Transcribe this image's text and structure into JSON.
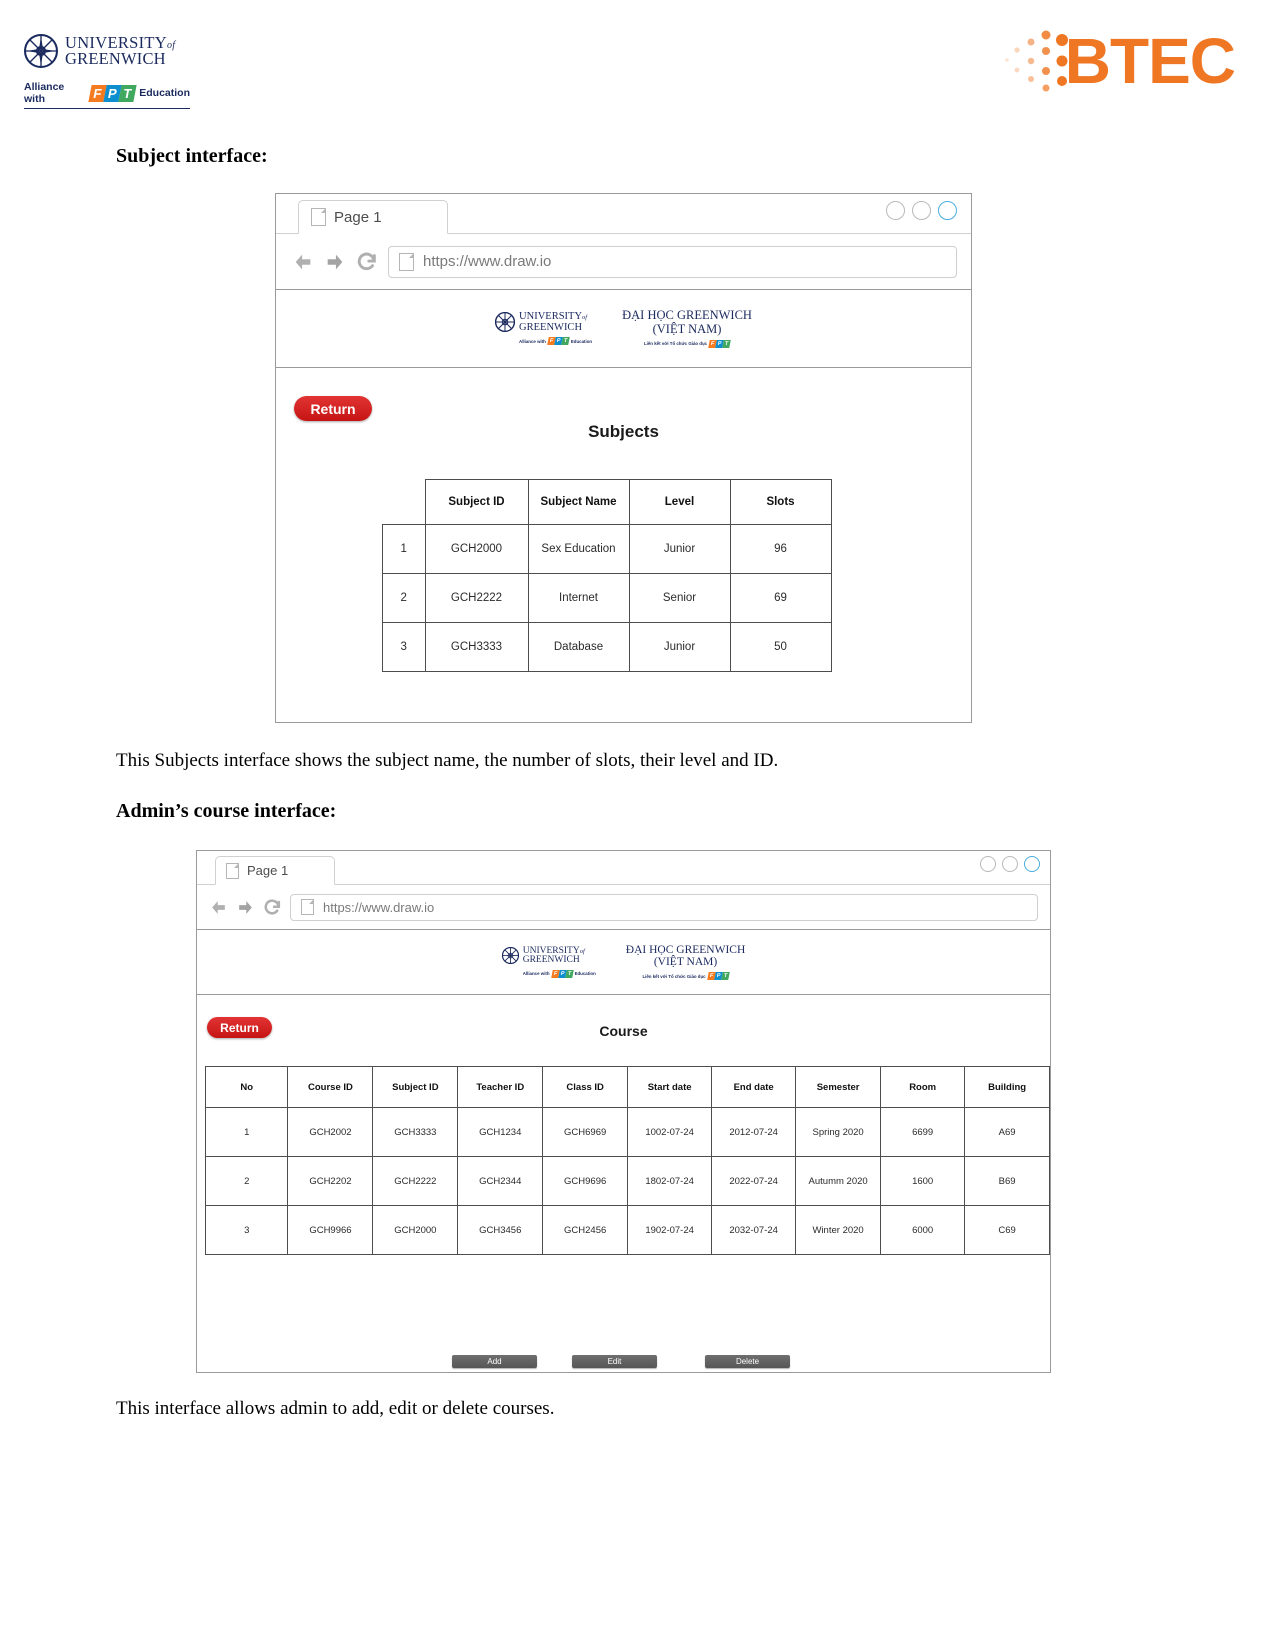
{
  "page_header": {
    "university_logo": {
      "icon": "greenwich-compass-icon",
      "line1": "UNIVERSITY",
      "line1_suffix": "of",
      "line2": "GREENWICH",
      "alliance_prefix": "Alliance with",
      "alliance_brand": "FPT",
      "alliance_suffix": "Education"
    },
    "btec_logo": {
      "icon": "btec-dots-icon",
      "text": "BTEC"
    }
  },
  "document": {
    "heading_1": "Subject interface:",
    "paragraph_1": "This Subjects interface shows the subject name, the number of slots, their level and ID.",
    "heading_2": "Admin’s course interface:",
    "paragraph_2": "This interface allows admin to add, edit or delete courses."
  },
  "browser_chrome": {
    "tab_label": "Page 1",
    "tab_icon": "page-icon",
    "back_icon": "back-arrow-icon",
    "forward_icon": "forward-arrow-icon",
    "reload_icon": "reload-icon",
    "url_icon": "page-icon",
    "url": "https://www.draw.io",
    "window_dots": [
      "minimize-dot",
      "maximize-dot",
      "close-dot"
    ]
  },
  "app_banner": {
    "uog_line1": "UNIVERSITY",
    "uog_of": "of",
    "uog_line2": "GREENWICH",
    "uog_alliance_prefix": "Alliance with",
    "uog_alliance_brand": "FPT",
    "uog_alliance_suffix": "Education",
    "vn_line1": "ĐẠI HỌC GREENWICH",
    "vn_line2": "(VIỆT NAM)",
    "vn_alliance_prefix": "Liên kết với Tổ chức Giáo dục",
    "vn_alliance_brand": "FPT"
  },
  "subjects_screen": {
    "return_label": "Return",
    "title": "Subjects",
    "table": {
      "corner": "",
      "columns": [
        "Subject ID",
        "Subject Name",
        "Level",
        "Slots"
      ],
      "rows": [
        {
          "no": "1",
          "cells": [
            "GCH2000",
            "Sex Education",
            "Junior",
            "96"
          ]
        },
        {
          "no": "2",
          "cells": [
            "GCH2222",
            "Internet",
            "Senior",
            "69"
          ]
        },
        {
          "no": "3",
          "cells": [
            "GCH3333",
            "Database",
            "Junior",
            "50"
          ]
        }
      ]
    }
  },
  "course_screen": {
    "return_label": "Return",
    "title": "Course",
    "table": {
      "columns": [
        "No",
        "Course ID",
        "Subject ID",
        "Teacher ID",
        "Class ID",
        "Start date",
        "End date",
        "Semester",
        "Room",
        "Building"
      ],
      "rows": [
        [
          "1",
          "GCH2002",
          "GCH3333",
          "GCH1234",
          "GCH6969",
          "1002-07-24",
          "2012-07-24",
          "Spring 2020",
          "6699",
          "A69"
        ],
        [
          "2",
          "GCH2202",
          "GCH2222",
          "GCH2344",
          "GCH9696",
          "1802-07-24",
          "2022-07-24",
          "Autumm 2020",
          "1600",
          "B69"
        ],
        [
          "3",
          "GCH9966",
          "GCH2000",
          "GCH3456",
          "GCH2456",
          "1902-07-24",
          "2032-07-24",
          "Winter 2020",
          "6000",
          "C69"
        ]
      ]
    },
    "actions": [
      "Add",
      "Edit",
      "Delete"
    ]
  },
  "colors": {
    "return_red": "#d61f1f",
    "btec_orange": "#ef7622",
    "uog_navy": "#1b2a5e",
    "action_gray": "#636363"
  }
}
